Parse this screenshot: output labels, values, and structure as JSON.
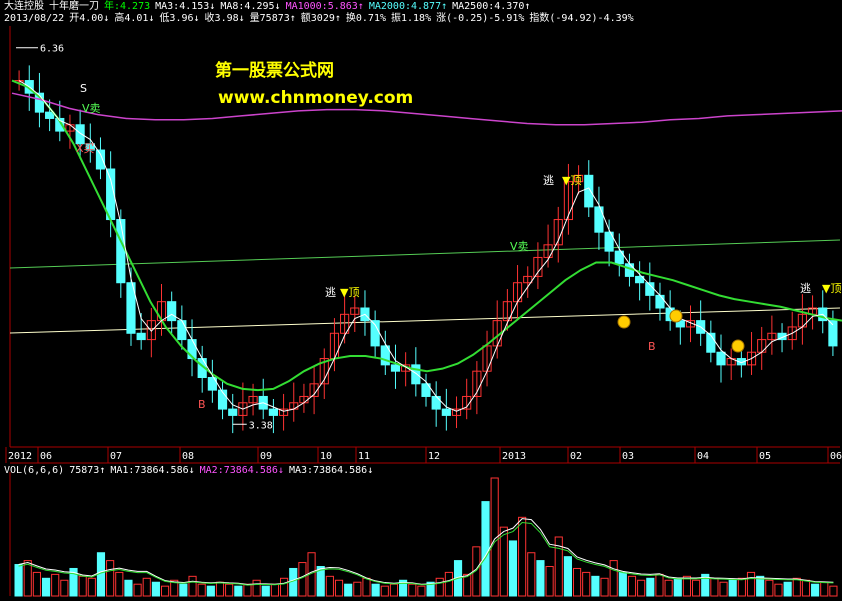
{
  "header": {
    "line1": [
      {
        "text": "大连控股",
        "color": "#ffffff"
      },
      {
        "text": "十年磨一刀",
        "color": "#ffffff"
      },
      {
        "text": "年:4.273",
        "color": "#00ff00"
      },
      {
        "text": "MA3:4.153↓",
        "color": "#ffffff"
      },
      {
        "text": "MA8:4.295↓",
        "color": "#ffffff"
      },
      {
        "text": "MA1000:5.863↑",
        "color": "#ff55ff"
      },
      {
        "text": "MA2000:4.877↑",
        "color": "#55ffff"
      },
      {
        "text": "MA2500:4.370↑",
        "color": "#ffffff"
      }
    ],
    "line2": [
      {
        "text": "2013/08/22",
        "color": "#ffffff"
      },
      {
        "text": "开4.00↓",
        "color": "#ffffff"
      },
      {
        "text": "高4.01↓",
        "color": "#ffffff"
      },
      {
        "text": "低3.96↓",
        "color": "#ffffff"
      },
      {
        "text": "收3.98↓",
        "color": "#ffffff"
      },
      {
        "text": "量75873↑",
        "color": "#ffffff"
      },
      {
        "text": "额3029↑",
        "color": "#ffffff"
      },
      {
        "text": "换0.71%",
        "color": "#ffffff"
      },
      {
        "text": "振1.18%",
        "color": "#ffffff"
      },
      {
        "text": "涨(-0.25)-5.91%",
        "color": "#ffffff"
      },
      {
        "text": "指数(-94.92)-4.39%",
        "color": "#ffffff"
      }
    ]
  },
  "volume_header": [
    {
      "text": "VOL(6,6,6)",
      "color": "#ffffff"
    },
    {
      "text": "75873↑",
      "color": "#ffffff"
    },
    {
      "text": "MA1:73864.586↓",
      "color": "#ffffff"
    },
    {
      "text": "MA2:73864.586↓",
      "color": "#ff55ff"
    },
    {
      "text": "MA3:73864.586↓",
      "color": "#ffffff"
    }
  ],
  "watermark": {
    "line1": "第一股票公式网",
    "line2": "www.chnmoney.com"
  },
  "colors": {
    "background": "#000000",
    "up": "#ff3333",
    "down": "#55ffff",
    "ma_green": "#33dd33",
    "ma_white": "#ffffff",
    "ma1000": "#cc44cc",
    "trend_line": "#55cc55",
    "support_line": "#ffffcc",
    "axis": "#aa0000",
    "sell_signal": "#55ff55",
    "buy_signal": "#ff3333"
  },
  "chart_data": [
    {
      "type": "candlestick",
      "ylim": [
        3.2,
        6.5
      ],
      "x_axis_labels": [
        "2012",
        "06",
        "07",
        "08",
        "09",
        "10",
        "11",
        "12",
        "2013",
        "02",
        "03",
        "04",
        "05",
        "06"
      ],
      "high_label": "6.36",
      "low_label": "3.38",
      "prices_close": [
        6.1,
        6.0,
        5.85,
        5.8,
        5.7,
        5.75,
        5.6,
        5.55,
        5.4,
        5.0,
        4.5,
        4.1,
        4.05,
        4.2,
        4.35,
        4.2,
        4.05,
        3.9,
        3.75,
        3.65,
        3.5,
        3.45,
        3.55,
        3.6,
        3.5,
        3.45,
        3.5,
        3.55,
        3.6,
        3.7,
        3.9,
        4.1,
        4.25,
        4.3,
        4.2,
        4.0,
        3.85,
        3.8,
        3.85,
        3.7,
        3.6,
        3.5,
        3.45,
        3.5,
        3.6,
        3.8,
        4.0,
        4.2,
        4.35,
        4.5,
        4.55,
        4.7,
        4.8,
        5.0,
        5.3,
        5.35,
        5.1,
        4.9,
        4.75,
        4.65,
        4.55,
        4.5,
        4.4,
        4.3,
        4.2,
        4.15,
        4.2,
        4.1,
        3.95,
        3.85,
        3.9,
        3.85,
        3.95,
        4.05,
        4.1,
        4.05,
        4.15,
        4.25,
        4.3,
        4.2,
        4.0
      ],
      "series": [
        {
          "name": "年",
          "values": [
            6.1,
            6.05,
            5.95,
            5.8,
            5.6,
            5.35,
            5.1,
            4.85,
            4.6,
            4.35,
            4.15,
            4.0,
            3.88,
            3.78,
            3.7,
            3.66,
            3.65,
            3.66,
            3.72,
            3.8,
            3.86,
            3.9,
            3.92,
            3.92,
            3.9,
            3.86,
            3.82,
            3.8,
            3.82,
            3.86,
            3.93,
            4.02,
            4.12,
            4.22,
            4.32,
            4.42,
            4.52,
            4.6,
            4.66,
            4.66,
            4.62,
            4.58,
            4.55,
            4.52,
            4.48,
            4.44,
            4.4,
            4.37,
            4.35,
            4.33,
            4.31,
            4.28,
            4.25,
            4.22,
            4.2
          ]
        },
        {
          "name": "MA1000",
          "values": [
            6.0,
            5.95,
            5.88,
            5.83,
            5.8,
            5.79,
            5.79,
            5.8,
            5.82,
            5.84,
            5.86,
            5.87,
            5.87,
            5.86,
            5.84,
            5.82,
            5.8,
            5.78,
            5.76,
            5.75,
            5.75,
            5.76,
            5.77,
            5.79,
            5.8,
            5.82,
            5.83,
            5.84,
            5.85,
            5.86
          ]
        }
      ]
    },
    {
      "type": "bar",
      "title": "VOL(6,6,6)",
      "values": [
        16,
        18,
        12,
        9,
        11,
        8,
        14,
        10,
        9,
        22,
        18,
        12,
        8,
        6,
        9,
        7,
        5,
        8,
        6,
        10,
        6,
        5,
        7,
        6,
        5,
        6,
        8,
        5,
        6,
        9,
        14,
        17,
        22,
        15,
        10,
        8,
        6,
        7,
        9,
        6,
        5,
        6,
        8,
        6,
        5,
        7,
        9,
        12,
        18,
        11,
        25,
        48,
        60,
        35,
        28,
        40,
        22,
        18,
        15,
        30,
        20,
        14,
        12,
        10,
        9,
        18,
        12,
        10,
        8,
        9,
        11,
        8,
        9,
        10,
        8,
        11,
        9,
        7,
        8,
        9,
        12,
        10,
        8,
        6,
        7,
        9,
        8,
        6,
        7,
        5
      ]
    }
  ],
  "signals": [
    {
      "label": "S",
      "color": "#ffffff"
    },
    {
      "label": "V卖",
      "color": "#55ff55"
    },
    {
      "label": "X买",
      "color": "#ff5555"
    },
    {
      "label": "逃",
      "color": "#ffffff"
    },
    {
      "label": "▼顶",
      "color": "#ffff00"
    },
    {
      "label": "B",
      "color": "#ff5555"
    },
    {
      "label": "V卖",
      "color": "#55ff55"
    },
    {
      "label": "逃",
      "color": "#ffffff"
    },
    {
      "label": "▼顶",
      "color": "#ffff00"
    },
    {
      "label": "逃",
      "color": "#ffffff"
    },
    {
      "label": "▼顶",
      "color": "#ffff00"
    },
    {
      "label": "B",
      "color": "#ff5555"
    }
  ]
}
